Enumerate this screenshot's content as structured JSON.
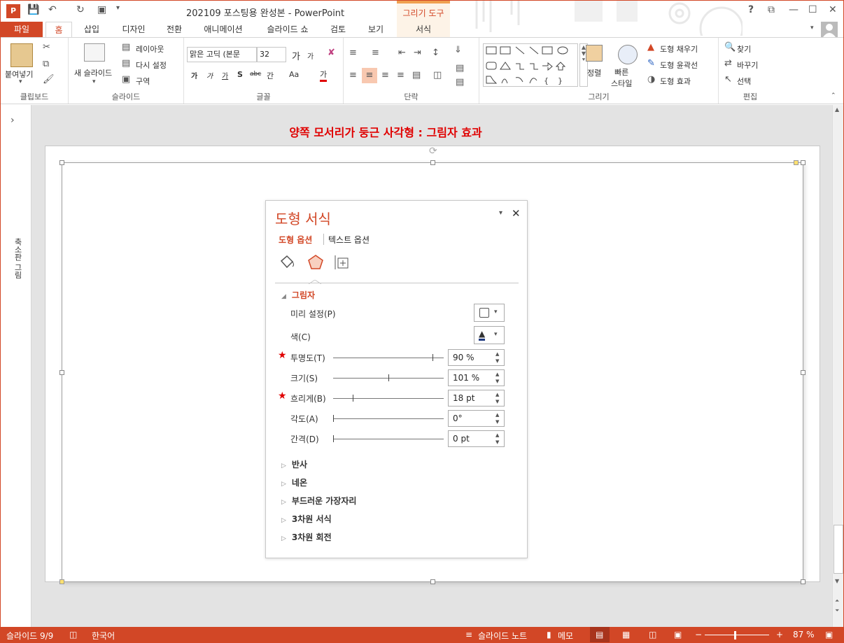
{
  "app": {
    "title": "202109 포스팅용 완성본 - PowerPoint",
    "contextual_group": "그리기 도구"
  },
  "window_controls": {
    "help": "?",
    "ribbon_display": "⧉",
    "minimize": "—",
    "maximize": "☐",
    "close": "✕"
  },
  "tabs": [
    "파일",
    "홈",
    "삽입",
    "디자인",
    "전환",
    "애니메이션",
    "슬라이드 쇼",
    "검토",
    "보기",
    "서식"
  ],
  "ribbon": {
    "clipboard": {
      "label": "클립보드",
      "paste": "붙여넣기"
    },
    "slides": {
      "label": "슬라이드",
      "new_slide": "새 슬라이드",
      "layout": "레이아웃",
      "reset": "다시 설정",
      "section": "구역"
    },
    "font": {
      "label": "글꼴",
      "font_name": "맑은 고딕 (본문",
      "font_size": "32",
      "grow": "가",
      "shrink": "가",
      "clear": "가",
      "bold": "가",
      "italic": "가",
      "underline": "가",
      "shadow": "S",
      "strike": "abc",
      "spacing": "간",
      "case": "Aa",
      "color": "가"
    },
    "paragraph": {
      "label": "단락"
    },
    "drawing": {
      "label": "그리기",
      "arrange": "정렬",
      "quick_styles": "빠른\n스타일",
      "fill": "도형 채우기",
      "outline": "도형 윤곽선",
      "effects": "도형 효과"
    },
    "editing": {
      "label": "편집",
      "find": "찾기",
      "replace": "바꾸기",
      "select": "선택"
    }
  },
  "side_pane": {
    "label": "축소판 그림",
    "expand": "›"
  },
  "slide": {
    "title": "양쪽 모서리가 둥근 사각형 : 그림자 효과"
  },
  "format_pane": {
    "title": "도형 서식",
    "tab_shape": "도형 옵션",
    "tab_text": "텍스트 옵션",
    "section": "그림자",
    "rows": [
      {
        "label": "미리 설정(P)"
      },
      {
        "label": "색(C)"
      },
      {
        "label": "투명도(T)",
        "value": "90 %",
        "fraction": 0.9,
        "starred": true
      },
      {
        "label": "크기(S)",
        "value": "101 %",
        "fraction": 0.5,
        "starred": false
      },
      {
        "label": "흐리게(B)",
        "value": "18 pt",
        "fraction": 0.18,
        "starred": true
      },
      {
        "label": "각도(A)",
        "value": "0°",
        "fraction": 0.0,
        "starred": false
      },
      {
        "label": "간격(D)",
        "value": "0 pt",
        "fraction": 0.0,
        "starred": false
      }
    ],
    "collapsed_sections": [
      "반사",
      "네온",
      "부드러운 가장자리",
      "3차원 서식",
      "3차원 회전"
    ]
  },
  "status": {
    "slide": "슬라이드 9/9",
    "language": "한국어",
    "notes": "슬라이드 노트",
    "comments": "메모",
    "zoom": "87 %"
  },
  "colors": {
    "accent": "#d24726",
    "star": "#e00000"
  }
}
